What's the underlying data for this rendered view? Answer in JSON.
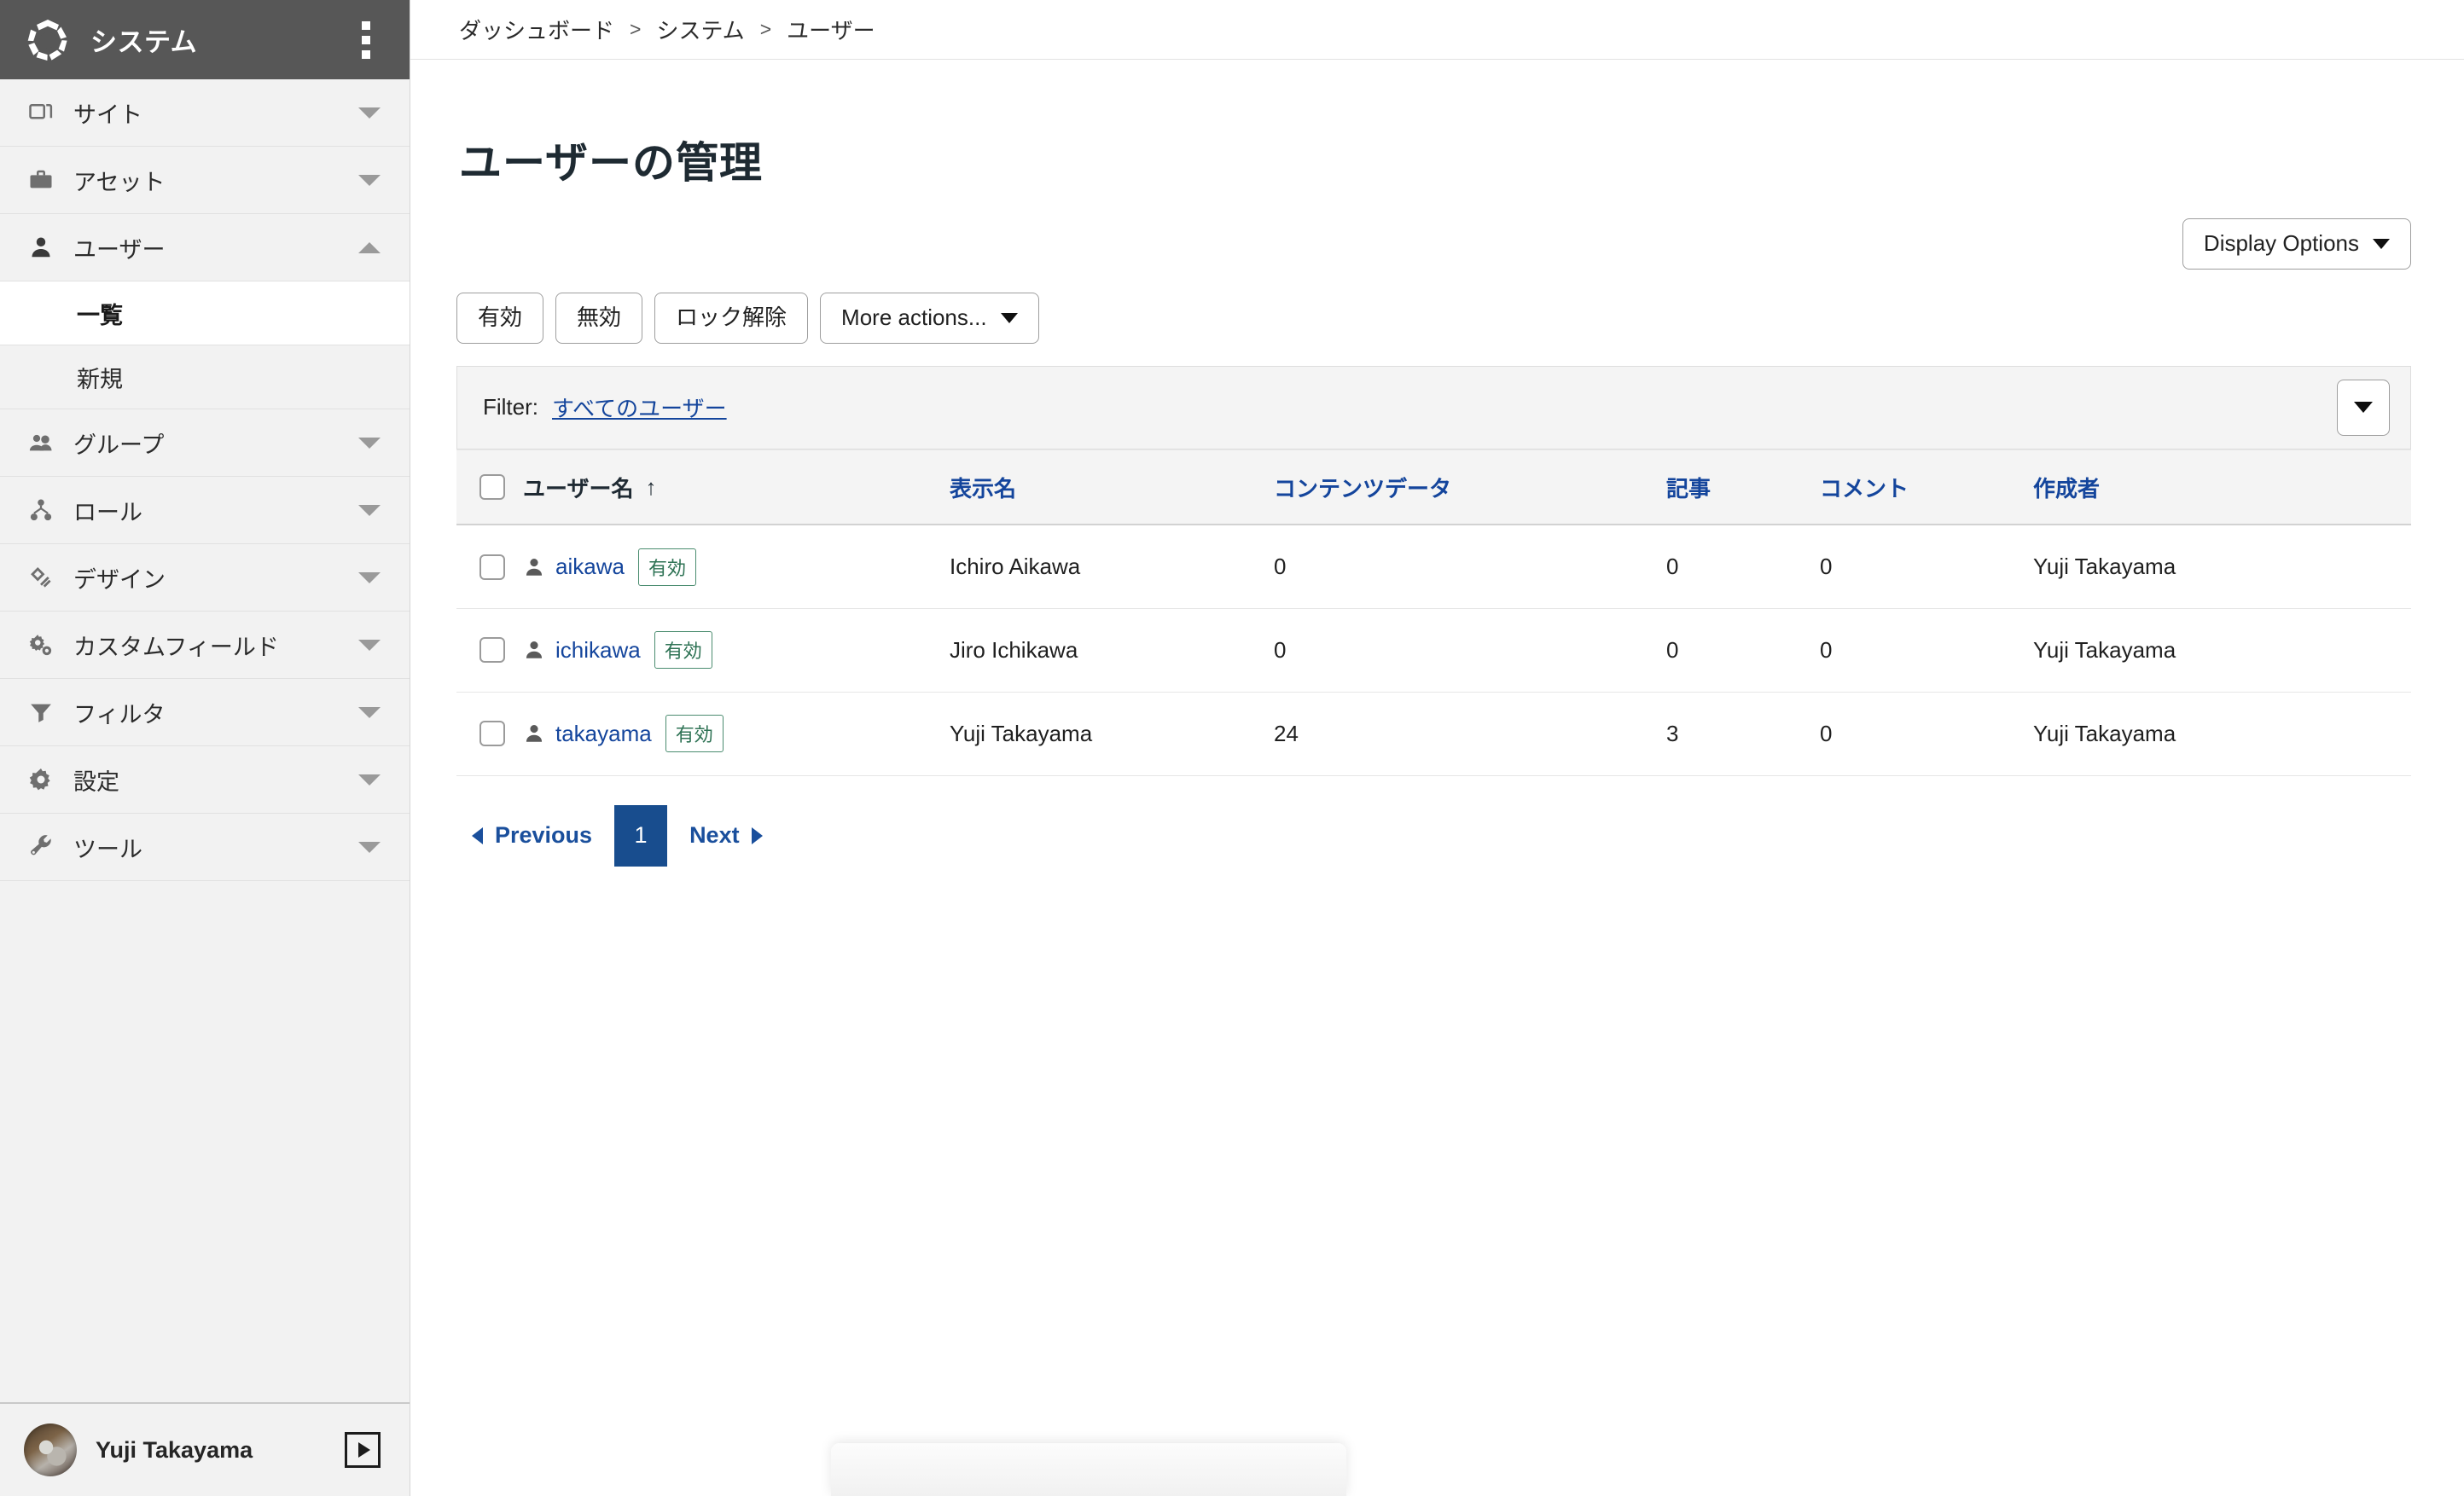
{
  "sidebar": {
    "brand": "システム",
    "kebab_icon": "kebab-menu-icon",
    "logo_icon": "segmented-ring-logo-icon",
    "items": [
      {
        "label": "サイト",
        "icon": "windows-icon",
        "expanded": false
      },
      {
        "label": "アセット",
        "icon": "briefcase-icon",
        "expanded": false
      },
      {
        "label": "ユーザー",
        "icon": "person-icon",
        "expanded": true
      },
      {
        "label": "グループ",
        "icon": "people-icon",
        "expanded": false
      },
      {
        "label": "ロール",
        "icon": "hierarchy-icon",
        "expanded": false
      },
      {
        "label": "デザイン",
        "icon": "brush-icon",
        "expanded": false
      },
      {
        "label": "カスタムフィールド",
        "icon": "gears-icon",
        "expanded": false
      },
      {
        "label": "フィルタ",
        "icon": "funnel-icon",
        "expanded": false
      },
      {
        "label": "設定",
        "icon": "gear-icon",
        "expanded": false
      },
      {
        "label": "ツール",
        "icon": "wrench-icon",
        "expanded": false
      }
    ],
    "subitems": [
      {
        "label": "一覧",
        "active": true
      },
      {
        "label": "新規",
        "active": false
      }
    ],
    "footer": {
      "user_name": "Yuji Takayama",
      "avatar_icon": "user-avatar",
      "expand_icon": "play-square-icon"
    }
  },
  "breadcrumb": {
    "items": [
      "ダッシュボード",
      "システム",
      "ユーザー"
    ],
    "separator": ">"
  },
  "page": {
    "title": "ユーザーの管理"
  },
  "toolbar": {
    "display_options_label": "Display Options",
    "actions": [
      {
        "label": "有効"
      },
      {
        "label": "無効"
      },
      {
        "label": "ロック解除"
      },
      {
        "label": "More actions...",
        "has_caret": true
      }
    ]
  },
  "filter": {
    "label": "Filter:",
    "value": "すべてのユーザー",
    "dropdown_icon": "chevron-down-icon"
  },
  "table": {
    "columns": [
      {
        "key": "checkbox",
        "label": "",
        "sorted": false
      },
      {
        "key": "username",
        "label": "ユーザー名",
        "sorted": true,
        "sort_dir": "↑"
      },
      {
        "key": "display",
        "label": "表示名",
        "sorted": false
      },
      {
        "key": "content",
        "label": "コンテンツデータ",
        "sorted": false
      },
      {
        "key": "articles",
        "label": "記事",
        "sorted": false
      },
      {
        "key": "comments",
        "label": "コメント",
        "sorted": false
      },
      {
        "key": "creator",
        "label": "作成者",
        "sorted": false
      }
    ],
    "rows": [
      {
        "username": "aikawa",
        "status": "有効",
        "display": "Ichiro Aikawa",
        "content": "0",
        "articles": "0",
        "comments": "0",
        "creator": "Yuji Takayama"
      },
      {
        "username": "ichikawa",
        "status": "有効",
        "display": "Jiro Ichikawa",
        "content": "0",
        "articles": "0",
        "comments": "0",
        "creator": "Yuji Takayama"
      },
      {
        "username": "takayama",
        "status": "有効",
        "display": "Yuji Takayama",
        "content": "24",
        "articles": "3",
        "comments": "0",
        "creator": "Yuji Takayama"
      }
    ]
  },
  "pagination": {
    "previous_label": "Previous",
    "next_label": "Next",
    "current_page": "1"
  },
  "colors": {
    "sidebar_header": "#575757",
    "sidebar_bg": "#f2f2f2",
    "link_blue": "#14459c",
    "pager_active": "#184d8e",
    "badge_green": "#2f7355"
  }
}
